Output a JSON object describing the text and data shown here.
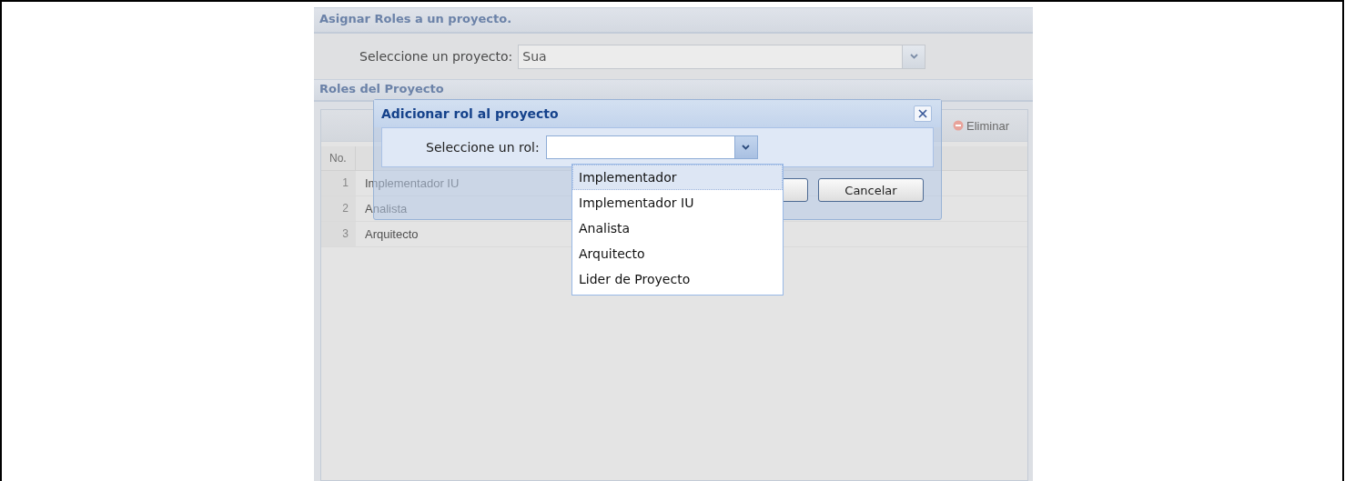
{
  "main_panel": {
    "title": "Asignar Roles a un proyecto.",
    "project_field": {
      "label": "Seleccione un proyecto:",
      "value": "Sua"
    }
  },
  "roles_panel": {
    "title": "Roles del Proyecto",
    "toolbar": {
      "delete_button": "Eliminar"
    },
    "table": {
      "columns": [
        "No."
      ],
      "rows": [
        {
          "number": "1",
          "role": "Implementador IU"
        },
        {
          "number": "2",
          "role": "Analista"
        },
        {
          "number": "3",
          "role": "Arquitecto"
        }
      ]
    }
  },
  "dialog": {
    "title": "Adicionar rol al proyecto",
    "role_field": {
      "label": "Seleccione un rol:",
      "expanded": true
    },
    "buttons": [
      {
        "label": "Cancelar"
      }
    ],
    "dropdown_options": [
      {
        "label": "Implementador",
        "selected": true
      },
      {
        "label": "Implementador IU",
        "selected": false
      },
      {
        "label": "Analista",
        "selected": false
      },
      {
        "label": "Arquitecto",
        "selected": false
      },
      {
        "label": "Lider de Proyecto",
        "selected": false
      }
    ]
  }
}
